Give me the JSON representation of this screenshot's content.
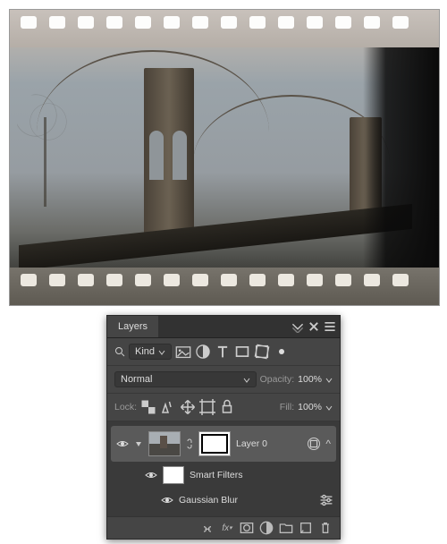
{
  "panel": {
    "title": "Layers",
    "filter": {
      "kind": "Kind"
    },
    "blend": {
      "mode": "Normal",
      "opacity_label": "Opacity:",
      "opacity_value": "100%"
    },
    "lock": {
      "label": "Lock:",
      "fill_label": "Fill:",
      "fill_value": "100%"
    },
    "layer": {
      "name": "Layer 0",
      "smart_filters_label": "Smart Filters",
      "filter_name": "Gaussian Blur"
    }
  },
  "icons": {
    "search": "search-icon",
    "image": "image-icon",
    "adjust": "adjust-icon",
    "type": "type-icon",
    "shape": "shape-icon",
    "smart": "smart-object-icon",
    "artboard": "artboard-icon",
    "lock_trans": "lock-transparency-icon",
    "lock_brush": "lock-image-icon",
    "lock_move": "lock-position-icon",
    "lock_art": "lock-artboard-icon",
    "lock_all": "lock-all-icon",
    "link": "link-icon",
    "fx": "fx-icon",
    "mask": "mask-icon",
    "fill": "fill-adjust-icon",
    "group": "group-icon",
    "new": "new-layer-icon",
    "trash": "trash-icon",
    "options": "filter-options-icon"
  }
}
